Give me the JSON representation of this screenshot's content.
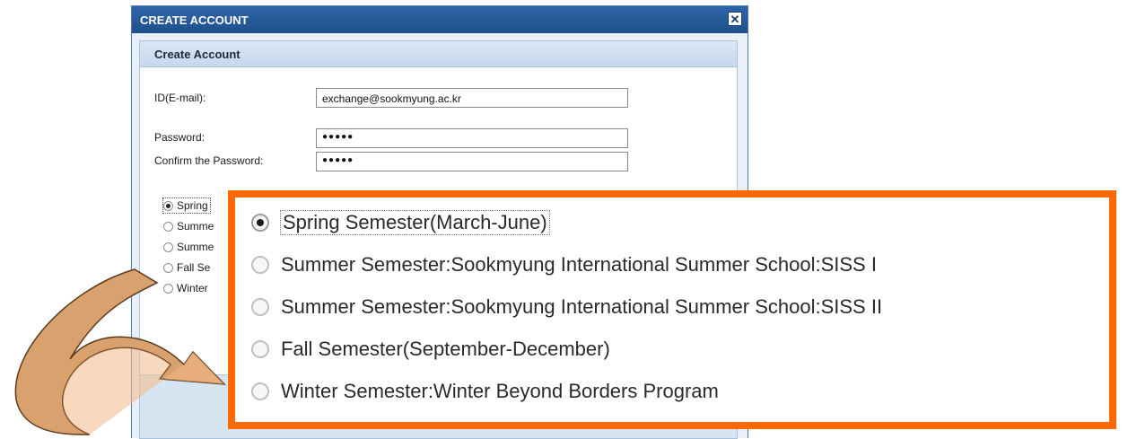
{
  "dialog": {
    "title": "CREATE ACCOUNT",
    "close_label": "✕",
    "panel_title": "Create Account"
  },
  "form": {
    "id_label": "ID(E-mail):",
    "id_value": "exchange@sookmyung.ac.kr",
    "password_label": "Password:",
    "password_value": "●●●●●",
    "confirm_label": "Confirm the Password:",
    "confirm_value": "●●●●●"
  },
  "small_options": [
    {
      "label": "Spring",
      "selected": true
    },
    {
      "label": "Summe",
      "selected": false
    },
    {
      "label": "Summe",
      "selected": false
    },
    {
      "label": "Fall Se",
      "selected": false
    },
    {
      "label": "Winter",
      "selected": false
    }
  ],
  "zoom_options": [
    {
      "label": "Spring Semester(March-June)",
      "selected": true
    },
    {
      "label": "Summer Semester:Sookmyung International Summer School:SISS I",
      "selected": false
    },
    {
      "label": "Summer Semester:Sookmyung International Summer School:SISS II",
      "selected": false
    },
    {
      "label": "Fall Semester(September-December)",
      "selected": false
    },
    {
      "label": "Winter Semester:Winter Beyond Borders Program",
      "selected": false
    }
  ],
  "colors": {
    "callout_border": "#ff6a00",
    "arrow_fill": "#d9a16d",
    "titlebar": "#1f4f8c"
  },
  "icons": {
    "close": "close-icon",
    "radio": "radio-icon",
    "arrow": "curved-arrow-icon"
  }
}
